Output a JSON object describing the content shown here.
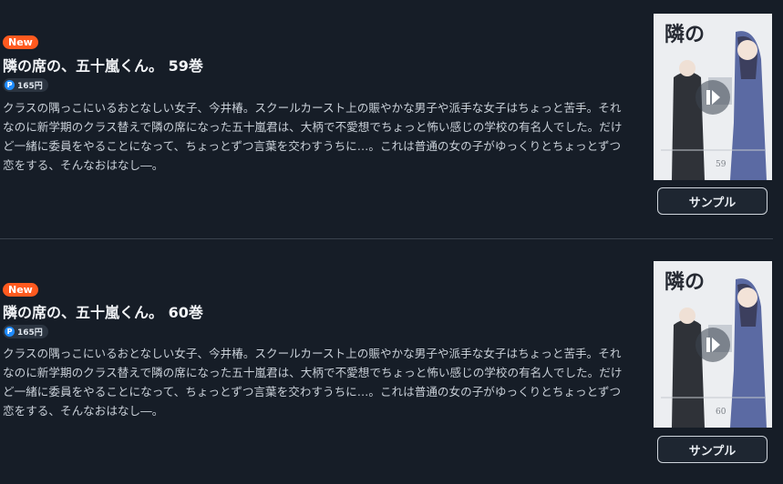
{
  "items": [
    {
      "badge": "New",
      "title": "隣の席の、五十嵐くん。 59巻",
      "price_icon": "P",
      "price": "165円",
      "description": "クラスの隅っこにいるおとなしい女子、今井椿。スクールカースト上の賑やかな男子や派手な女子はちょっと苦手。それなのに新学期のクラス替えで隣の席になった五十嵐君は、大柄で不愛想でちょっと怖い感じの学校の有名人でした。だけど一緒に委員をやることになって、ちょっとずつ言葉を交わすうちに…。これは普通の女の子がゆっくりとちょっとずつ恋をする、そんなおはなし―。",
      "cover": {
        "title": "隣の席の、五十嵐くん。",
        "volume": "59"
      },
      "sample_label": "サンプル"
    },
    {
      "badge": "New",
      "title": "隣の席の、五十嵐くん。 60巻",
      "price_icon": "P",
      "price": "165円",
      "description": "クラスの隅っこにいるおとなしい女子、今井椿。スクールカースト上の賑やかな男子や派手な女子はちょっと苦手。それなのに新学期のクラス替えで隣の席になった五十嵐君は、大柄で不愛想でちょっと怖い感じの学校の有名人でした。だけど一緒に委員をやることになって、ちょっとずつ言葉を交わすうちに…。これは普通の女の子がゆっくりとちょっとずつ恋をする、そんなおはなし―。",
      "cover": {
        "title": "隣の席の、五十嵐くん。",
        "volume": "60"
      },
      "sample_label": "サンプル"
    }
  ],
  "colors": {
    "background": "#161d27",
    "badge_new": "#ff5a1f",
    "point_icon": "#1f8cff"
  },
  "icons": {
    "cover_overlay": "play-icon",
    "price": "point-icon"
  }
}
